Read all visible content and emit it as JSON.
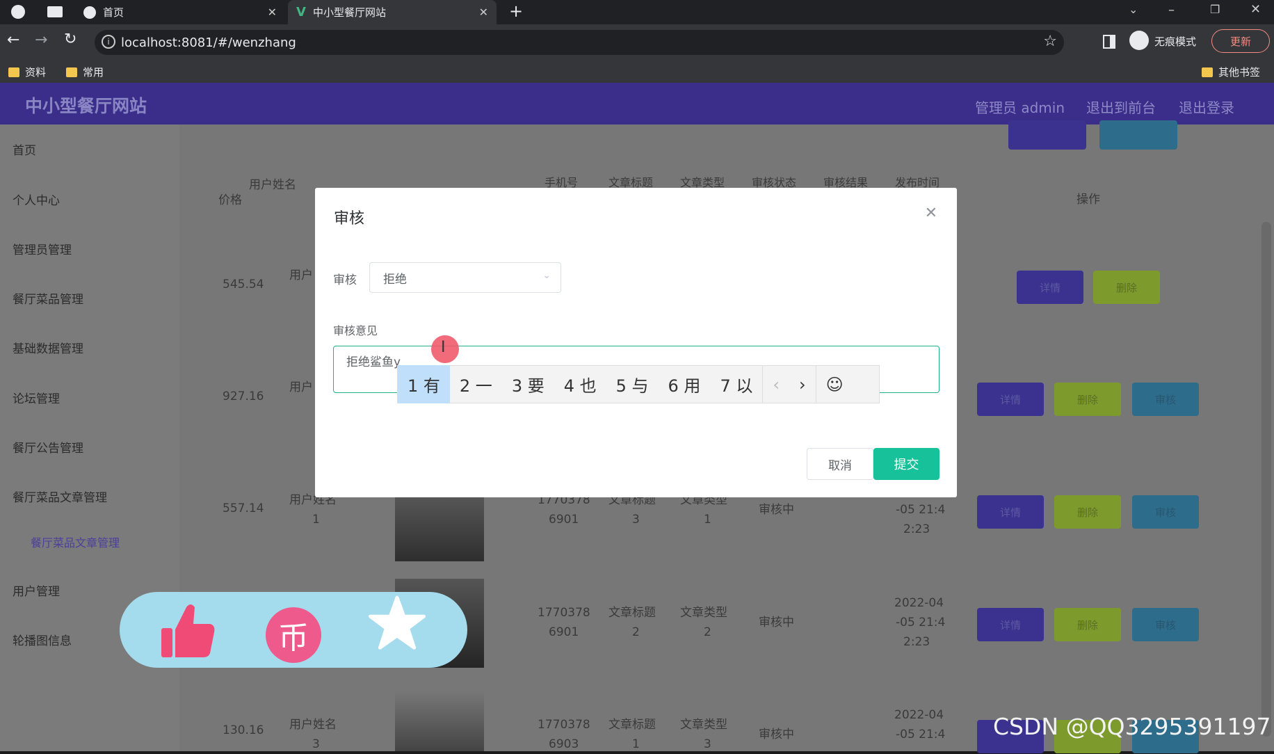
{
  "browser": {
    "tabs": [
      {
        "label": "首页"
      },
      {
        "label": "中小型餐厅网站"
      }
    ],
    "url": "localhost:8081/#/wenzhang",
    "incognito_label": "无痕模式",
    "update_label": "更新",
    "bookmarks": [
      "资料",
      "常用"
    ],
    "other_bookmarks": "其他书签"
  },
  "app": {
    "brand": "中小型餐厅网站",
    "nav": [
      "管理员 admin",
      "退出到前台",
      "退出登录"
    ],
    "sidebar": [
      "首页",
      "个人中心",
      "管理员管理",
      "餐厅菜品管理",
      "基础数据管理",
      "论坛管理",
      "餐厅公告管理",
      "餐厅菜品文章管理",
      "餐厅菜品文章管理",
      "用户管理",
      "轮播图信息"
    ],
    "table_headers": {
      "price": "价格",
      "user_name": "用户姓名",
      "phone": "手机号",
      "article_title": "文章标题",
      "article_type": "文章类型",
      "review_status": "审核状态",
      "review_result": "审核结果",
      "publish_time": "发布时间",
      "actions": "操作"
    },
    "rows": [
      {
        "price": "545.54",
        "user": "用户"
      },
      {
        "price": "927.16",
        "user": "用户"
      },
      {
        "price": "557.14",
        "user_a": "用户姓名",
        "user_b": "1",
        "phone_a": "1770378",
        "phone_b": "6901",
        "title_a": "文章标题",
        "title_b": "3",
        "type_a": "文章类型",
        "type_b": "1",
        "status": "审核中",
        "time_a": "-05 21:4",
        "time_b": "2:23"
      },
      {
        "phone_a": "1770378",
        "phone_b": "6901",
        "title_a": "文章标题",
        "title_b": "2",
        "type_a": "文章类型",
        "type_b": "2",
        "status": "审核中",
        "time_a": "2022-04",
        "time_b": "-05 21:4",
        "time_c": "2:23"
      },
      {
        "price": "130.16",
        "user_a": "用户姓名",
        "user_b": "3",
        "phone_a": "1770378",
        "phone_b": "6903",
        "title_a": "文章标题",
        "title_b": "1",
        "type_a": "文章类型",
        "type_b": "3",
        "status": "审核中",
        "time_a": "2022-04",
        "time_b": "-05 21:4"
      }
    ],
    "btn_detail": "详情",
    "btn_delete": "删除",
    "btn_review": "审核"
  },
  "modal": {
    "title": "审核",
    "select_label": "审核",
    "select_value": "拒绝",
    "opinion_label": "审核意见",
    "opinion_value": "拒绝鲨鱼y",
    "ime_candidates": [
      "1 有",
      "2 一",
      "3 要",
      "4 也",
      "5 与",
      "6 用",
      "7 以"
    ],
    "cancel": "取消",
    "submit": "提交"
  },
  "watermark": "CSDN @QQ3295391197",
  "colors": {
    "accent": "#17c29a",
    "nav": "#3a2e8a",
    "detail": "#3b3290",
    "delete": "#7d9a2d",
    "review": "#2d6c8a"
  }
}
